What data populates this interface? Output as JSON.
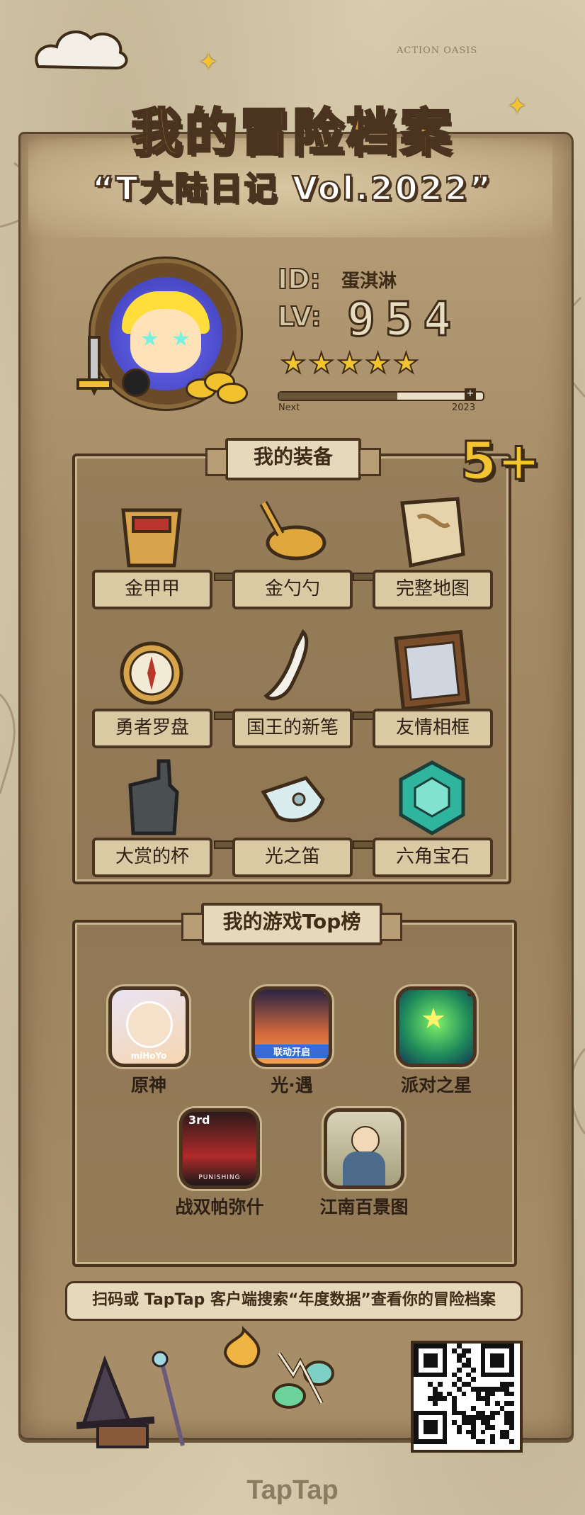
{
  "header": {
    "title": "我的冒险档案",
    "subtitle": "“T大陆日记 Vol.2022”",
    "map_label": "ACTION OASIS"
  },
  "profile": {
    "id_label": "ID:",
    "id_value": "蛋淇淋",
    "lv_label": "LV:",
    "lv_value": "954",
    "stars": 5,
    "progress_fraction": 0.58,
    "progress_start": "Next",
    "progress_end": "2023",
    "badge": "5+"
  },
  "equipment": {
    "title": "我的装备",
    "items": [
      {
        "label": "金甲甲",
        "icon": "armor-icon"
      },
      {
        "label": "金勺勺",
        "icon": "spoon-icon"
      },
      {
        "label": "完整地图",
        "icon": "map-icon"
      },
      {
        "label": "勇者罗盘",
        "icon": "compass-icon"
      },
      {
        "label": "国王的新笔",
        "icon": "pen-icon"
      },
      {
        "label": "友情相框",
        "icon": "frame-icon"
      },
      {
        "label": "大赏的杯",
        "icon": "glove-icon"
      },
      {
        "label": "光之笛",
        "icon": "whistle-icon"
      },
      {
        "label": "六角宝石",
        "icon": "gem-icon"
      }
    ]
  },
  "top_games": {
    "title": "我的游戏Top榜",
    "games": [
      {
        "name": "原神",
        "crown": true
      },
      {
        "name": "光·遇",
        "crown": true
      },
      {
        "name": "派对之星",
        "crown": true
      },
      {
        "name": "战双帕弥什",
        "crown": false
      },
      {
        "name": "江南百景图",
        "crown": false
      }
    ],
    "icon_texts": {
      "genshin": "miHoYo",
      "sky": "联动开启",
      "pgr_top": "3rd",
      "pgr_bottom": "PUNISHING"
    }
  },
  "footer": {
    "search_text": "扫码或 TapTap 客户端搜索“年度数据”查看你的冒险档案",
    "logo": "TapTap"
  }
}
